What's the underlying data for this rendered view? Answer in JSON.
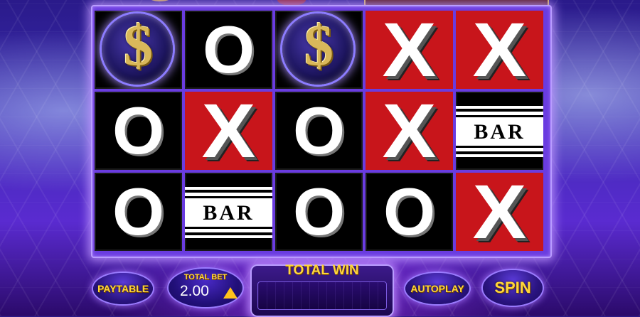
{
  "reels": [
    [
      "dollar",
      "O",
      "dollar",
      "X",
      "X"
    ],
    [
      "O",
      "X",
      "O",
      "X",
      "BAR"
    ],
    [
      "O",
      "BAR",
      "O",
      "O",
      "X"
    ]
  ],
  "symbols": {
    "dollar": "$",
    "x": "X",
    "o": "O",
    "bar": "BAR"
  },
  "controls": {
    "paytable_label": "PAYTABLE",
    "total_bet_label": "TOTAL BET",
    "total_bet_value": "2.00",
    "total_win_label": "TOTAL WIN",
    "total_win_value": "",
    "autoplay_label": "AUTOPLAY",
    "spin_label": "SPIN"
  },
  "colors": {
    "x_tile": "#c8151b",
    "button_text": "#ffd63a",
    "frame_glow": "#b99cff"
  }
}
